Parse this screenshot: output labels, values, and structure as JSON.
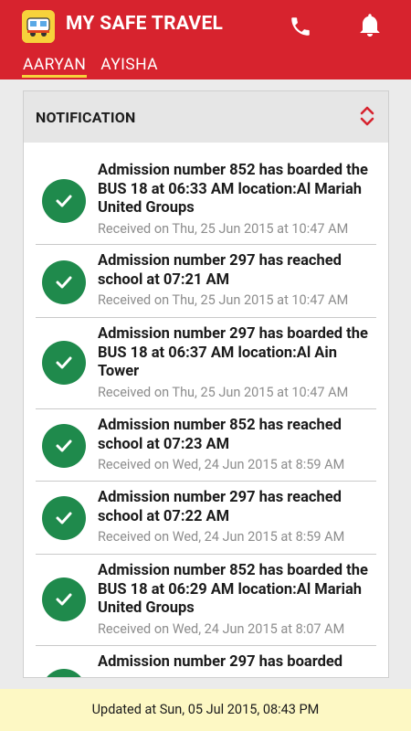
{
  "app": {
    "title": "MY SAFE TRAVEL"
  },
  "tabs": [
    {
      "label": "AARYAN",
      "active": true
    },
    {
      "label": "AYISHA",
      "active": false
    }
  ],
  "panel": {
    "title": "NOTIFICATION"
  },
  "notifications": [
    {
      "message": "Admission number 852 has boarded the BUS 18 at 06:33 AM location:Al Mariah United Groups",
      "received": "Received on Thu, 25 Jun 2015 at 10:47 AM"
    },
    {
      "message": "Admission number 297 has reached school at 07:21 AM",
      "received": "Received on Thu, 25 Jun 2015 at 10:47 AM"
    },
    {
      "message": "Admission number 297 has boarded the BUS 18 at 06:37 AM location:Al Ain Tower",
      "received": "Received on Thu, 25 Jun 2015 at 10:47 AM"
    },
    {
      "message": "Admission number 852 has reached school at 07:23 AM",
      "received": "Received on Wed, 24 Jun 2015 at 8:59 AM"
    },
    {
      "message": "Admission number 297 has reached school at 07:22 AM",
      "received": "Received on Wed, 24 Jun 2015 at 8:59 AM"
    },
    {
      "message": "Admission number 852 has boarded the BUS 18 at 06:29 AM location:Al Mariah United Groups",
      "received": "Received on Wed, 24 Jun 2015 at 8:07 AM"
    },
    {
      "message": "Admission number 297 has boarded",
      "received": ""
    }
  ],
  "footer": {
    "updated": "Updated at Sun, 05 Jul 2015, 08:43 PM"
  },
  "colors": {
    "brand_red": "#d7232e",
    "tab_underline": "#f7d23b",
    "check_green": "#1f8a4c",
    "footer_bg": "#fdf8c4"
  }
}
